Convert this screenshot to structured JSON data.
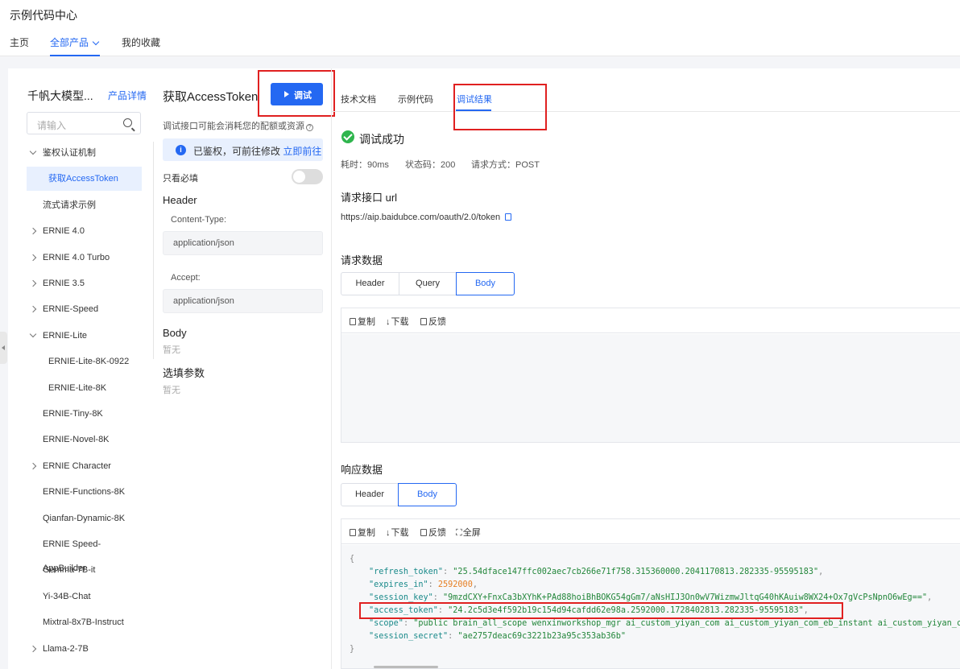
{
  "app": {
    "title": "示例代码中心"
  },
  "nav": {
    "home": "主页",
    "all_products": "全部产品",
    "favorites": "我的收藏"
  },
  "sidebar": {
    "product_name": "千帆大模型...",
    "product_detail_link": "产品详情",
    "search_placeholder": "请输入",
    "items": [
      {
        "label": "鉴权认证机制",
        "arrow": "down"
      },
      {
        "label": "获取AccessToken",
        "active": true
      },
      {
        "label": "流式请求示例"
      },
      {
        "label": "ERNIE 4.0",
        "arrow": "right"
      },
      {
        "label": "ERNIE 4.0 Turbo",
        "arrow": "right"
      },
      {
        "label": "ERNIE 3.5",
        "arrow": "right"
      },
      {
        "label": "ERNIE-Speed",
        "arrow": "right"
      },
      {
        "label": "ERNIE-Lite",
        "arrow": "down"
      },
      {
        "label": "ERNIE-Lite-8K-0922"
      },
      {
        "label": "ERNIE-Lite-8K"
      },
      {
        "label": "ERNIE-Tiny-8K"
      },
      {
        "label": "ERNIE-Novel-8K"
      },
      {
        "label": "ERNIE Character",
        "arrow": "right"
      },
      {
        "label": "ERNIE-Functions-8K"
      },
      {
        "label": "Qianfan-Dynamic-8K"
      },
      {
        "label": "ERNIE Speed-AppBuilder"
      },
      {
        "label": "Gemma-7B-it"
      },
      {
        "label": "Yi-34B-Chat"
      },
      {
        "label": "Mixtral-8x7B-Instruct"
      },
      {
        "label": "Llama-2-7B",
        "arrow": "right"
      }
    ]
  },
  "middle": {
    "title": "获取AccessToken",
    "debug_button": "调试",
    "hint": "调试接口可能会消耗您的配额或资源",
    "notice": "已鉴权，可前往修改",
    "notice_link": "立即前往",
    "required_only": "只看必填",
    "header_section": "Header",
    "content_type_label": "Content-Type:",
    "content_type_value": "application/json",
    "accept_label": "Accept:",
    "accept_value": "application/json",
    "body_section": "Body",
    "body_empty": "暂无",
    "optional_section": "选填参数",
    "optional_empty": "暂无"
  },
  "right": {
    "tabs": [
      "技术文档",
      "示例代码",
      "调试结果"
    ],
    "active_tab": "调试结果",
    "status": "调试成功",
    "elapsed": "耗时：90ms",
    "status_code": "状态码：200",
    "method": "请求方式：POST",
    "url_heading": "请求接口 url",
    "url": "https://aip.baidubce.com/oauth/2.0/token",
    "request_heading": "请求数据",
    "request_tabs": [
      "Header",
      "Query",
      "Body"
    ],
    "request_active": "Body",
    "request_tools": [
      "复制",
      "下载",
      "反馈"
    ],
    "response_heading": "响应数据",
    "response_tabs": [
      "Header",
      "Body"
    ],
    "response_active": "Body",
    "response_tools": [
      "复制",
      "下载",
      "反馈",
      "全屏"
    ],
    "response_json": {
      "open": "{",
      "close": "}",
      "lines": [
        {
          "key": "\"refresh_token\"",
          "value": "\"25.54dface147ffc002aec7cb266e71f758.315360000.2041170813.282335-95595183\"",
          "kind": "str"
        },
        {
          "key": "\"expires_in\"",
          "value": "2592000",
          "kind": "num"
        },
        {
          "key": "\"session_key\"",
          "value": "\"9mzdCXY+FnxCa3bXYhK+PAd88hoiBhBOKG54gGm7/aNsHIJ3On0wV7WizmwJltqG40hKAuiw8WX24+Ox7gVcPsNpnO6wEg==\"",
          "kind": "str"
        },
        {
          "key": "\"access_token\"",
          "value": "\"24.2c5d3e4f592b19c154d94cafdd62e98a.2592000.1728402813.282335-95595183\"",
          "kind": "str"
        },
        {
          "key": "\"scope\"",
          "value": "\"public brain_all_scope wenxinworkshop_mgr ai_custom_yiyan_com ai_custom_yiyan_com_eb_instant ai_custom_yiyan_com_b",
          "kind": "str"
        },
        {
          "key": "\"session_secret\"",
          "value": "\"ae2757deac69c3221b23a95c353ab36b\"",
          "kind": "str"
        }
      ]
    }
  },
  "colors": {
    "accent": "#2468f2",
    "success": "#2fb54d",
    "highlight": "#e02020"
  }
}
